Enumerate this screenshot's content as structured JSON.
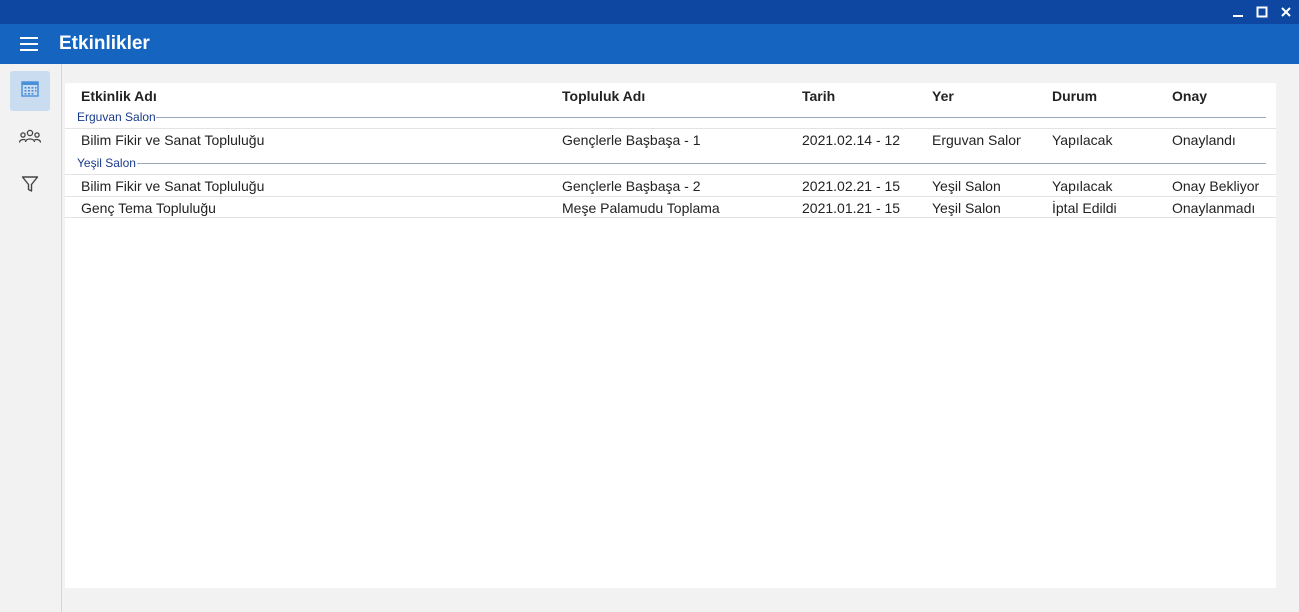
{
  "window": {
    "minimize_icon": "minimize-icon",
    "maximize_icon": "maximize-icon",
    "close_icon": "close-icon"
  },
  "appbar": {
    "title": "Etkinlikler",
    "menu_icon": "hamburger-menu-icon",
    "background": "#1565c0",
    "titlebar_background": "#0d47a1"
  },
  "sidebar": {
    "items": [
      {
        "icon": "calendar-icon",
        "active": true
      },
      {
        "icon": "community-icon",
        "active": false
      },
      {
        "icon": "filter-icon",
        "active": false
      }
    ]
  },
  "table": {
    "columns": [
      "Etkinlik Adı",
      "Topluluk Adı",
      "Tarih",
      "Yer",
      "Durum",
      "Onay"
    ],
    "groups": [
      {
        "label": "Erguvan Salon",
        "rows": [
          [
            "Bilim Fikir ve Sanat Topluluğu",
            "Gençlerle Başbaşa - 1",
            "2021.02.14 - 12",
            "Erguvan Salon",
            "Yapılacak",
            "Onaylandı"
          ]
        ]
      },
      {
        "label": "Yeşil Salon",
        "rows": [
          [
            "Bilim Fikir ve Sanat Topluluğu",
            "Gençlerle Başbaşa - 2",
            "2021.02.21 - 15",
            "Yeşil Salon",
            "Yapılacak",
            "Onay Bekliyor"
          ],
          [
            "Genç Tema Topluluğu",
            "Meşe Palamudu Toplama",
            "2021.01.21 - 15",
            "Yeşil Salon",
            "İptal Edildi",
            "Onaylanmadı"
          ]
        ]
      }
    ]
  }
}
